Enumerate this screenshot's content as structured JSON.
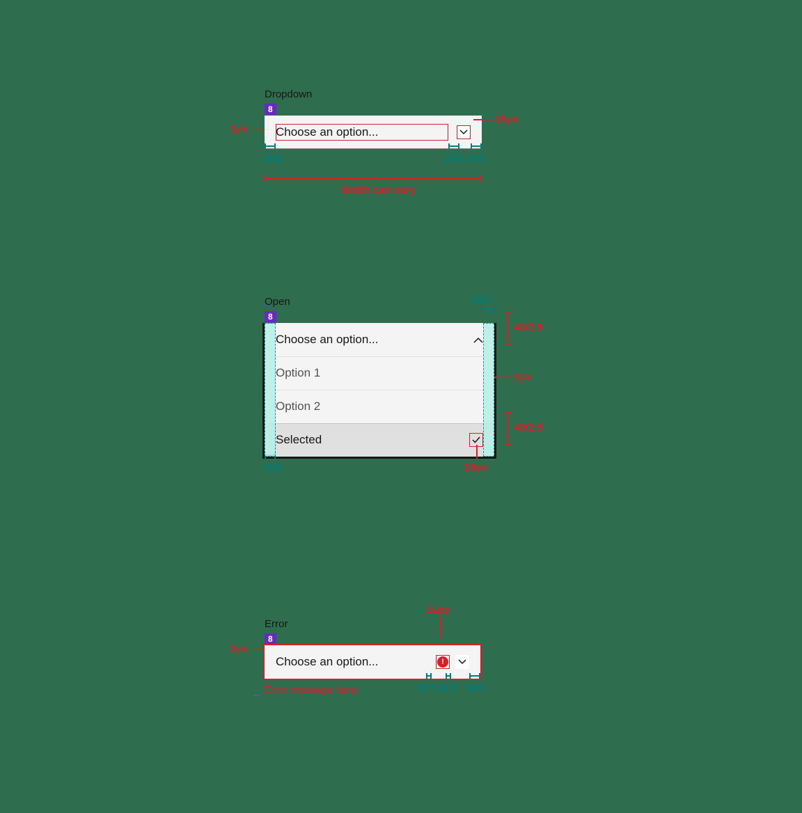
{
  "spec1": {
    "state_label": "Dropdown",
    "badge": "8",
    "placeholder": "Choose an option...",
    "ann_border": "1px",
    "ann_icon_size": "16px",
    "ann_pad_left": "16/1",
    "ann_pad_mid": "16/1",
    "ann_pad_right": "16/1",
    "ann_width": "Width can vary"
  },
  "spec2": {
    "state_label": "Open",
    "badge": "8",
    "placeholder": "Choose an option...",
    "option1": "Option 1",
    "option2": "Option 2",
    "selected": "Selected",
    "ann_top_pad": "16/1",
    "ann_row_h": "40/2.5",
    "ann_divider": "1px",
    "ann_row_h2": "40/2.5",
    "ann_icon_size": "16px",
    "ann_pad_left": "16/1"
  },
  "spec3": {
    "state_label": "Error",
    "badge": "8",
    "placeholder": "Choose an option...",
    "error_message": "Error message here",
    "ann_border": "2px",
    "ann_icon_size": "16px",
    "ann_gap1": "8/.5",
    "ann_gap2": "8/.5",
    "ann_pad_right": "16/1"
  }
}
